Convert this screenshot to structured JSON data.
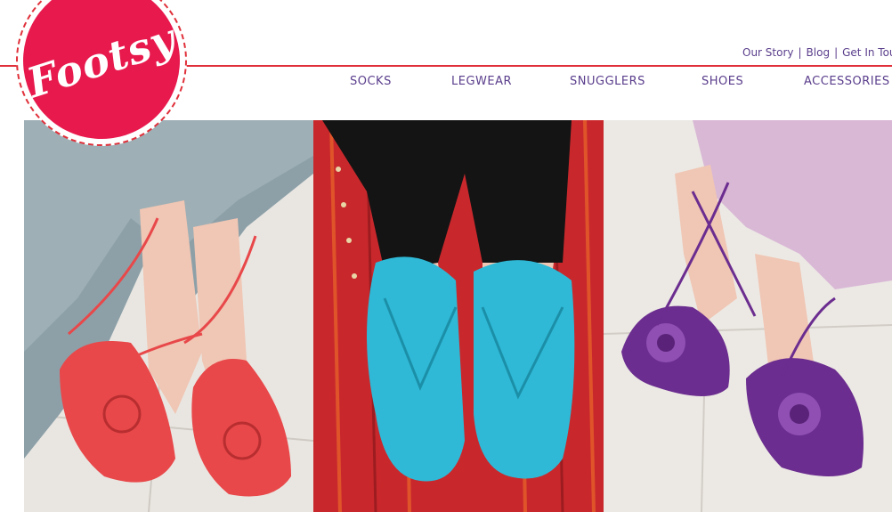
{
  "brand": {
    "logo_text": "Footsy"
  },
  "top_links": [
    {
      "label": "Our Story"
    },
    {
      "label": "Blog"
    },
    {
      "label": "Get In Tou"
    }
  ],
  "top_links_separator": "|",
  "nav": {
    "items": [
      {
        "label": "SOCKS"
      },
      {
        "label": "LEGWEAR"
      },
      {
        "label": "SNUGGLERS"
      },
      {
        "label": "SHOES"
      },
      {
        "label": "ACCESSORIES"
      }
    ]
  },
  "colors": {
    "accent_red": "#e0303a",
    "logo_pink": "#e8194d",
    "nav_purple": "#5a3e8c"
  },
  "hero": {
    "panels": [
      {
        "shoe_color": "#e8484a"
      },
      {
        "shoe_color": "#2fb9d6"
      },
      {
        "shoe_color": "#6b2d8f"
      }
    ]
  }
}
